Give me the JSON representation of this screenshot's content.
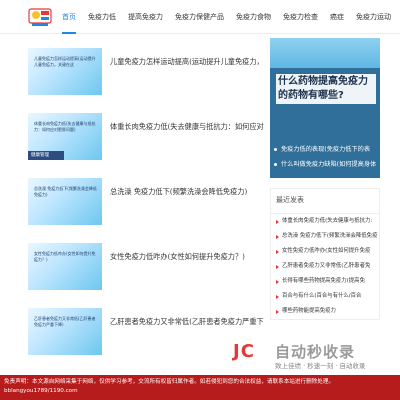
{
  "nav": {
    "items": [
      {
        "label": "首页",
        "active": true
      },
      {
        "label": "免疫力低",
        "active": false
      },
      {
        "label": "提高免疫力",
        "active": false
      },
      {
        "label": "免疫力保健产品",
        "active": false
      },
      {
        "label": "免疫力食物",
        "active": false
      },
      {
        "label": "免疫力检查",
        "active": false
      },
      {
        "label": "癌症",
        "active": false
      },
      {
        "label": "免疫力运动",
        "active": false
      }
    ]
  },
  "articles": [
    {
      "title": "儿童免疫力怎样运动提高(运动提升儿童免疫力，关键在",
      "thumb_text": "儿童免疫力怎样运动提高(运动提升儿童免疫力，关键在这",
      "thumb_footer": ""
    },
    {
      "title": "体重长肉免疫力低(失去健康与抵抗力：如何应对肥胖问",
      "thumb_text": "体重长肉免疫力低(失去健康与抵抗力：如何应对肥胖问题)",
      "thumb_footer": "健康管理"
    },
    {
      "title": "总洗澡 免疫力低下(频繁洗澡会降低免疫力)",
      "thumb_text": "总洗澡 免疫力低下(频繁洗澡会降低免疫力)",
      "thumb_footer": ""
    },
    {
      "title": "女性免疫力低咋办(女性如何提升免疫力？)",
      "thumb_text": "女性免疫力低咋办(女性如何提升免疫力？)",
      "thumb_footer": ""
    },
    {
      "title": "乙肝患者免疫力又非常低(乙肝患者免疫力严重下降)",
      "thumb_text": "乙肝患者免疫力又非常低(乙肝患者免疫力严重下降)",
      "thumb_footer": ""
    }
  ],
  "feature": {
    "title": "什么药物提高免疫力的药物有哪些?",
    "links": [
      "免疫力低的表现(免疫力低下的表",
      "什么叫做免疫力缺陷(如何提高身体"
    ]
  },
  "recent": {
    "heading": "最近发表",
    "items": [
      "体重长肉免疫力低(失去健康与抵抗力:",
      "总洗澡 免疫力低下(频繁洗澡会降低免疫",
      "女性免疫力低咋办(女性如何提升免疫",
      "乙肝患者免疫力又非常低(乙肝患者免",
      "长得有哪些药物提高免疫力(提高免",
      "百合与有什么(百合与有什么/百合",
      "哪些药物能提高免疫力"
    ]
  },
  "watermark": {
    "logo": "JC",
    "text": "自动秒收录",
    "sub": "致上佳绩 · 秒速一刻 · 自动收录"
  },
  "banner": {
    "line1": "免责声明：本文源自网络采集于网络，仅供学习参考，交流所有权皆归属作者。如若侵犯到您的合法权益，请联系本站进行删除处理。",
    "line2": "bblangyou1789/1190.com"
  }
}
